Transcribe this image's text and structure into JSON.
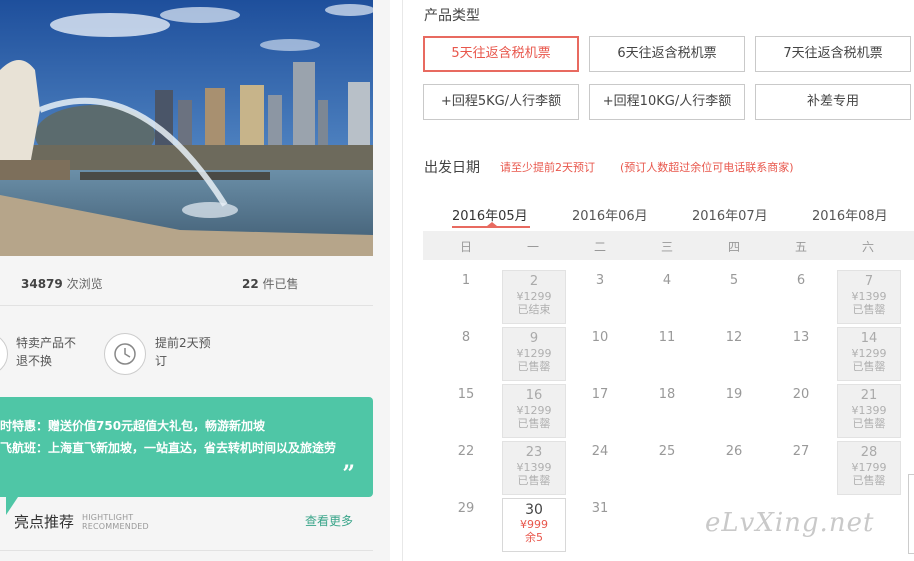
{
  "stats": {
    "views_count": "34879",
    "views_label": "次浏览",
    "sold_count": "22",
    "sold_label": "件已售"
  },
  "features": [
    {
      "text1": "特卖产品不",
      "text2": "退不换"
    },
    {
      "text1": "提前2天预",
      "text2": "订"
    }
  ],
  "promo": {
    "line1": "时特惠：赠送价值750元超值大礼包，畅游新加坡",
    "line2": "飞航班：上海直飞新加坡，一站直达，省去转机时间以及旅途劳",
    "quote": "”"
  },
  "highlight": {
    "title": "亮点推荐",
    "en_line1": "HIGHTLIGHT",
    "en_line2": "RECOMMENDED",
    "more": "查看更多"
  },
  "product_type": {
    "label": "产品类型",
    "options": [
      "5天往返含税机票",
      "6天往返含税机票",
      "7天往返含税机票",
      "+回程5KG/人行李额",
      "+回程10KG/人行李额",
      "补差专用"
    ]
  },
  "date": {
    "label": "出发日期",
    "tip1": "请至少提前2天预订",
    "tip2": "(预订人数超过余位可电话联系商家)"
  },
  "months": [
    "2016年05月",
    "2016年06月",
    "2016年07月",
    "2016年08月"
  ],
  "weekdays": [
    "日",
    "一",
    "二",
    "三",
    "四",
    "五",
    "六"
  ],
  "days": {
    "d2": {
      "num": "2",
      "price": "¥1299",
      "status": "已结束"
    },
    "d3": "3",
    "d4": "4",
    "d5": "5",
    "d6": "6",
    "d7": {
      "num": "7",
      "price": "¥1399",
      "status": "已售罄"
    },
    "d1": "1",
    "d8": "8",
    "d9": {
      "num": "9",
      "price": "¥1299",
      "status": "已售罄"
    },
    "d10": "10",
    "d11": "11",
    "d12": "12",
    "d13": "13",
    "d14": {
      "num": "14",
      "price": "¥1299",
      "status": "已售罄"
    },
    "d15": "15",
    "d16": {
      "num": "16",
      "price": "¥1299",
      "status": "已售罄"
    },
    "d17": "17",
    "d18": "18",
    "d19": "19",
    "d20": "20",
    "d21": {
      "num": "21",
      "price": "¥1399",
      "status": "已售罄"
    },
    "d22": "22",
    "d23": {
      "num": "23",
      "price": "¥1399",
      "status": "已售罄"
    },
    "d24": "24",
    "d25": "25",
    "d26": "26",
    "d27": "27",
    "d28": {
      "num": "28",
      "price": "¥1799",
      "status": "已售罄"
    },
    "d29": "29",
    "d30": {
      "num": "30",
      "price": "¥999",
      "status": "余5"
    },
    "d31": "31"
  },
  "watermark": "eLvXing.net",
  "colors": {
    "accent": "#e8574c",
    "promo": "#4fc6a6",
    "link": "#3aa58a"
  }
}
